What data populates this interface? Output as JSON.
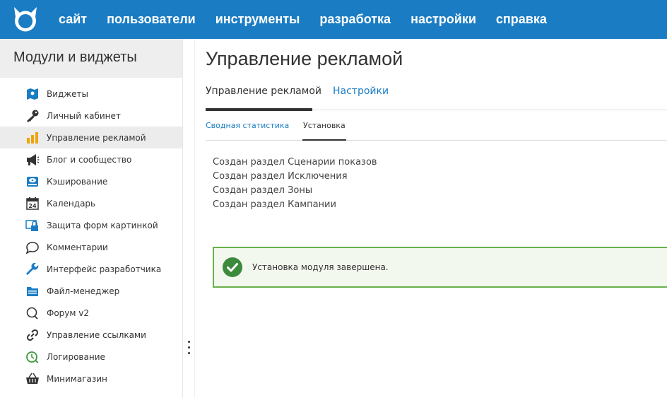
{
  "topnav": {
    "items": [
      "сайт",
      "пользователи",
      "инструменты",
      "разработка",
      "настройки",
      "справка"
    ]
  },
  "sidebar": {
    "title": "Модули и виджеты",
    "items": [
      {
        "label": "Виджеты",
        "icon": "map-icon"
      },
      {
        "label": "Личный кабинет",
        "icon": "key-icon"
      },
      {
        "label": "Управление рекламой",
        "icon": "bar-chart-icon",
        "active": true
      },
      {
        "label": "Блог и сообщество",
        "icon": "megaphone-icon"
      },
      {
        "label": "Кэширование",
        "icon": "hard-drive-icon"
      },
      {
        "label": "Календарь",
        "icon": "calendar-icon"
      },
      {
        "label": "Защита форм картинкой",
        "icon": "captcha-lock-icon"
      },
      {
        "label": "Комментарии",
        "icon": "speech-bubble-icon"
      },
      {
        "label": "Интерфейс разработчика",
        "icon": "wrench-icon"
      },
      {
        "label": "Файл-менеджер",
        "icon": "folder-icon"
      },
      {
        "label": "Форум v2",
        "icon": "forum-bubble-icon"
      },
      {
        "label": "Управление ссылками",
        "icon": "link-icon"
      },
      {
        "label": "Логирование",
        "icon": "log-clock-icon"
      },
      {
        "label": "Минимагазин",
        "icon": "basket-icon"
      }
    ]
  },
  "main": {
    "title": "Управление рекламой",
    "tabs": [
      {
        "label": "Управление рекламой",
        "active": true
      },
      {
        "label": "Настройки",
        "active": false
      }
    ],
    "subtabs": [
      {
        "label": "Сводная статистика",
        "active": false
      },
      {
        "label": "Установка",
        "active": true
      }
    ],
    "messages": [
      "Создан раздел Сценарии показов",
      "Создан раздел Исключения",
      "Создан раздел Зоны",
      "Создан раздел Кампании"
    ],
    "alert": {
      "text": "Установка модуля завершена.",
      "icon": "check-circle-icon",
      "color": "#6ab04c"
    }
  },
  "colors": {
    "accent": "#1a7dc4",
    "success": "#6ab04c"
  }
}
